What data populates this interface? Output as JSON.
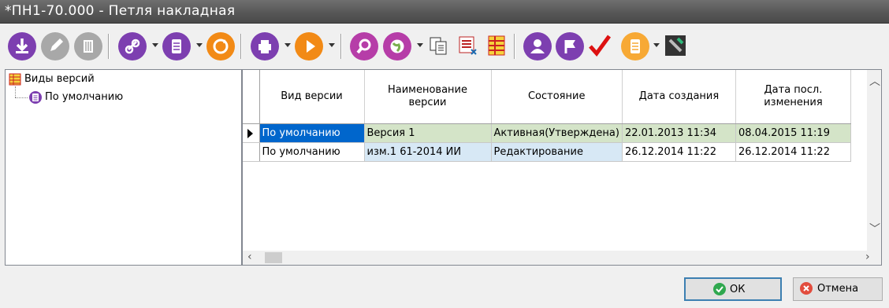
{
  "window": {
    "title": "*ПН1-70.000 - Петля накладная"
  },
  "toolbar": {
    "icons": [
      "download-icon",
      "edit-icon",
      "delete-icon",
      "link-icon",
      "document-icon",
      "refresh-icon",
      "print-icon",
      "play-icon",
      "search-icon",
      "globe-icon",
      "copy-icon",
      "report-icon",
      "table-icon",
      "user-icon",
      "flag-icon",
      "check-icon",
      "list-icon",
      "tool-icon"
    ]
  },
  "tree": {
    "root": "Виды версий",
    "children": [
      "По умолчанию"
    ]
  },
  "grid": {
    "columns": [
      "Вид версии",
      "Наименование версии",
      "Состояние",
      "Дата создания",
      "Дата посл. изменения"
    ],
    "rows": [
      [
        "По умолчанию",
        "Версия 1",
        "Активная(Утверждена)",
        "22.01.2013 11:34",
        "08.04.2015 11:19"
      ],
      [
        "По умолчанию",
        "изм.1 61-2014 ИИ",
        "Редактирование",
        "26.12.2014 11:22",
        "26.12.2014 11:22"
      ]
    ]
  },
  "buttons": {
    "ok": "ОК",
    "cancel": "Отмена"
  },
  "colors": {
    "selected": "#0066cc",
    "row_active": "#d4e4c8",
    "row_edit": "#d7e8f5",
    "ok_icon": "#2fa84f",
    "cancel_icon": "#e24c3d"
  }
}
